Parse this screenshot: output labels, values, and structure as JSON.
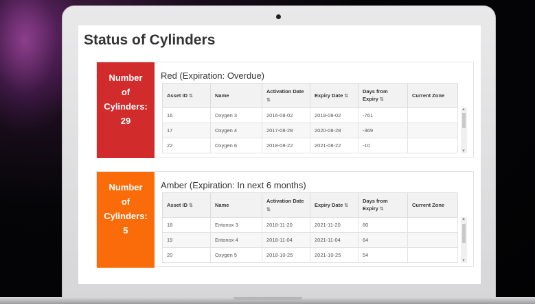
{
  "page": {
    "title": "Status of Cylinders"
  },
  "red": {
    "count_lines": [
      "Number",
      "of",
      "Cylinders:",
      "29"
    ],
    "heading": "Red (Expiration: Overdue)",
    "color": "#d22b2b",
    "rows": [
      [
        "16",
        "Oxygen 3",
        "2016-08-02",
        "2019-08-02",
        "-761",
        ""
      ],
      [
        "17",
        "Oxygen 4",
        "2017-08-28",
        "2020-08-28",
        "-369",
        ""
      ],
      [
        "22",
        "Oxygen 6",
        "2018-08-22",
        "2021-08-22",
        "-10",
        ""
      ]
    ]
  },
  "amber": {
    "count_lines": [
      "Number",
      "of",
      "Cylinders:",
      "5"
    ],
    "heading": "Amber (Expiration: In next 6 months)",
    "color": "#fa6b0a",
    "rows": [
      [
        "18",
        "Entonox 3",
        "2018-11-20",
        "2021-11-20",
        "80",
        ""
      ],
      [
        "19",
        "Entonox 4",
        "2018-11-04",
        "2021-11-04",
        "64",
        ""
      ],
      [
        "20",
        "Oxygen 5",
        "2018-10-25",
        "2021-10-25",
        "54",
        ""
      ]
    ]
  },
  "columns": [
    {
      "label": "Asset ID",
      "sortable": true
    },
    {
      "label": "Name",
      "sortable": false
    },
    {
      "label": "Activation Date",
      "sortable": true
    },
    {
      "label": "Expiry Date",
      "sortable": true
    },
    {
      "label": "Days from Expiry",
      "sortable": true
    },
    {
      "label": "Current Zone",
      "sortable": false
    }
  ],
  "icons": {
    "sort": "sort-icon",
    "scroll_up": "scroll-up-icon",
    "scroll_down": "scroll-down-icon"
  }
}
